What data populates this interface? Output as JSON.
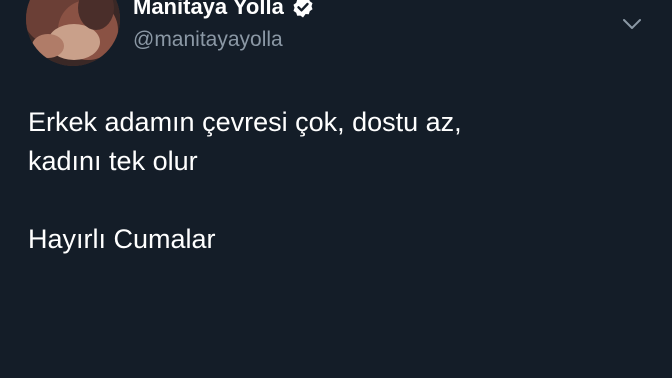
{
  "tweet": {
    "author_name": "Manitaya Yolla",
    "handle": "@manitayayolla",
    "text": "Erkek adamın çevresi çok, dostu az,\nkadını tek olur\n\nHayırlı Cumalar"
  },
  "icons": {
    "avatar": "profile-photo",
    "verified": "verified-badge-icon",
    "menu": "chevron-down-icon"
  },
  "colors": {
    "background": "#141d28",
    "text": "#ffffff",
    "secondary_text": "#8b98a5"
  }
}
